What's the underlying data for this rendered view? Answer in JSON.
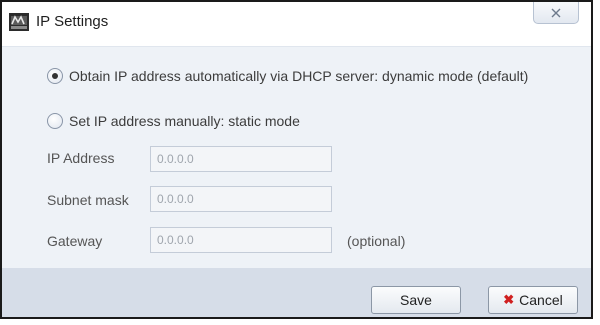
{
  "window": {
    "title": "IP Settings",
    "close_glyph": "✕",
    "app_icon": "app-logo-icon"
  },
  "mode": {
    "dhcp_label": "Obtain IP address automatically via DHCP server: dynamic mode (default)",
    "static_label": "Set IP address manually: static mode",
    "selected": "dhcp"
  },
  "fields": {
    "ip_label": "IP Address",
    "ip_value": "0.0.0.0",
    "subnet_label": "Subnet mask",
    "subnet_value": "0.0.0.0",
    "gateway_label": "Gateway",
    "gateway_value": "0.0.0.0",
    "gateway_hint": "(optional)"
  },
  "buttons": {
    "save": "Save",
    "cancel": "Cancel",
    "cancel_icon": "✖"
  },
  "colors": {
    "footer_bg": "#d6dde8",
    "content_bg": "#eef2f7",
    "cancel_icon": "#d02020"
  }
}
